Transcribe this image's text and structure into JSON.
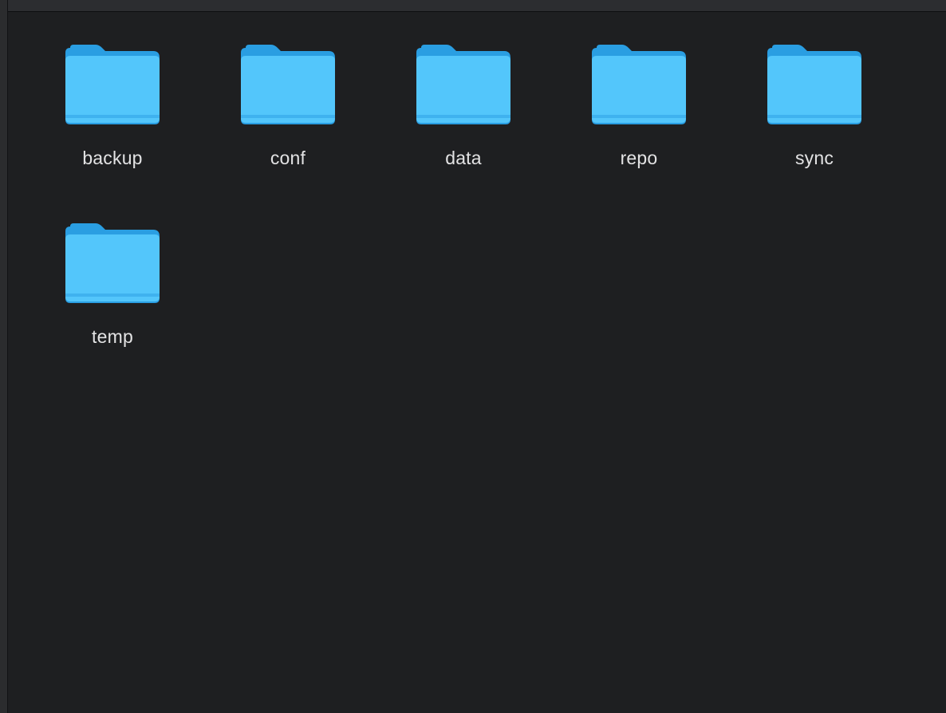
{
  "finder": {
    "items": [
      {
        "name": "backup",
        "icon": "folder-icon"
      },
      {
        "name": "conf",
        "icon": "folder-icon"
      },
      {
        "name": "data",
        "icon": "folder-icon"
      },
      {
        "name": "repo",
        "icon": "folder-icon"
      },
      {
        "name": "sync",
        "icon": "folder-icon"
      },
      {
        "name": "temp",
        "icon": "folder-icon"
      }
    ]
  },
  "colors": {
    "background": "#1e1f21",
    "folder_front": "#53c6fb",
    "folder_back": "#2a9ee2",
    "label_text": "#e3e3e4"
  }
}
